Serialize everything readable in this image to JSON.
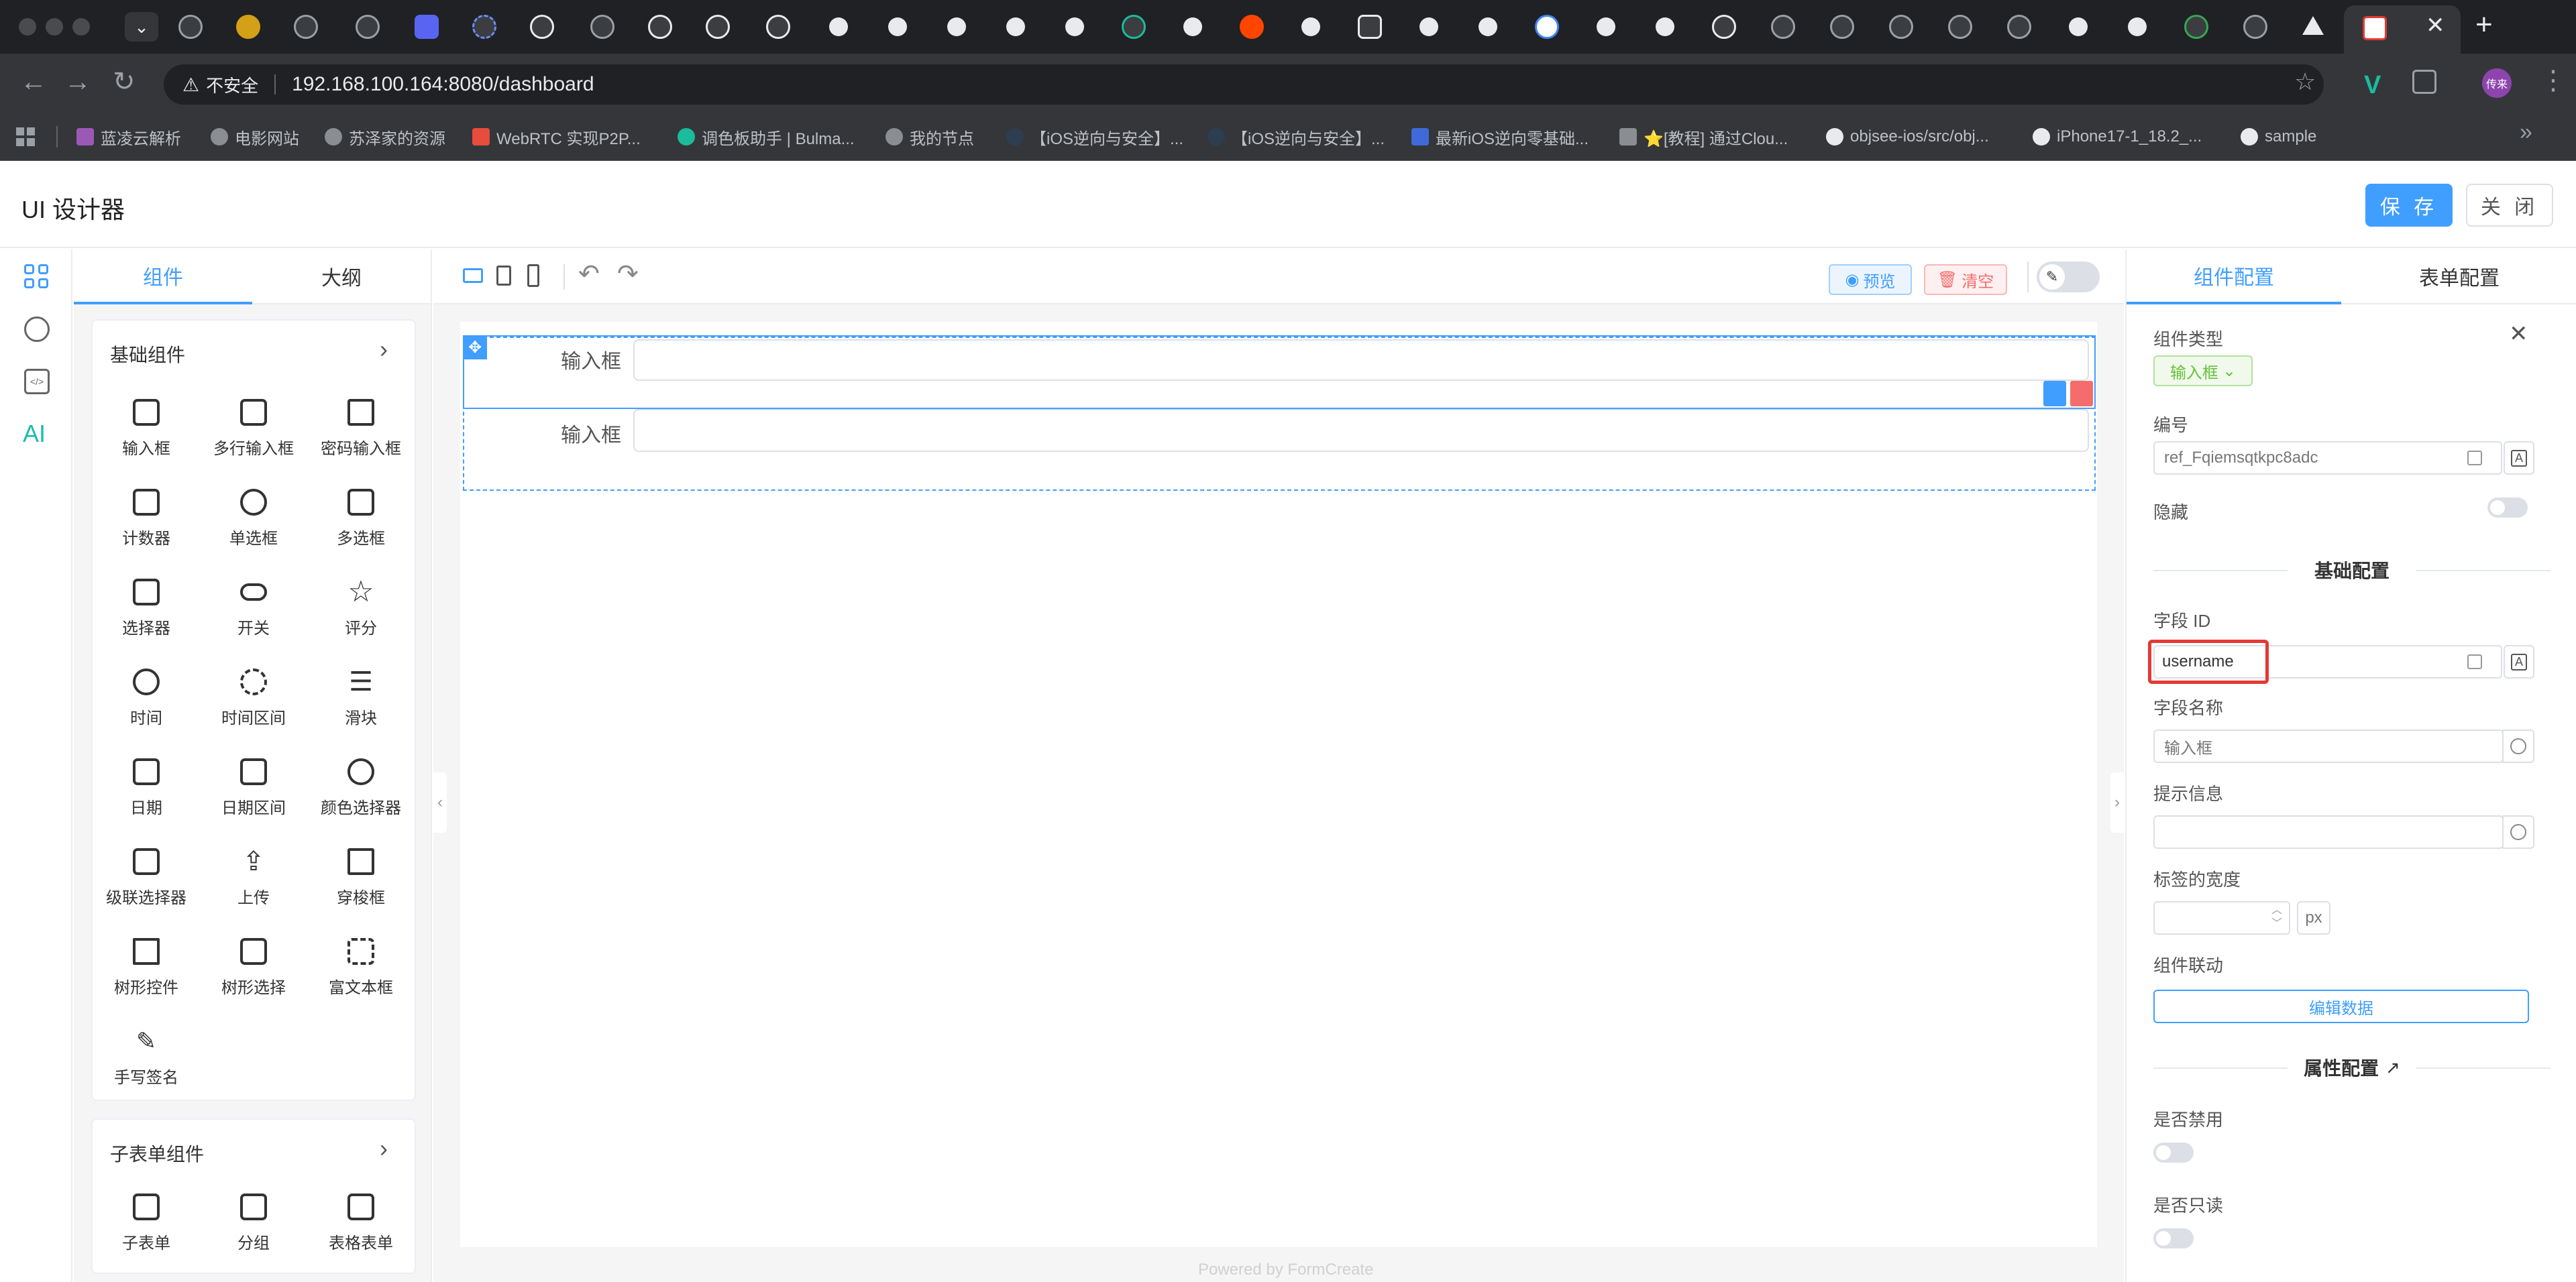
{
  "browser": {
    "url": "192.168.100.164:8080/dashboard",
    "not_secure_label": "不安全",
    "bookmarks": [
      "蓝凌云解析",
      "电影网站",
      "苏泽家的资源",
      "WebRTC 实现P2P...",
      "调色板助手 | Bulma...",
      "我的节点",
      "【iOS逆向与安全】...",
      "【iOS逆向与安全】...",
      "最新iOS逆向零基础...",
      "⭐[教程] 通过Clou...",
      "objsee-ios/src/obj...",
      "iPhone17-1_18.2_...",
      "sample"
    ],
    "profile_label": "传来"
  },
  "app": {
    "title": "UI 设计器",
    "save_label": "保 存",
    "close_label": "关 闭",
    "rail_ai_label": "AI",
    "left_tabs": [
      "组件",
      "大纲"
    ],
    "groups": [
      {
        "title": "基础组件",
        "items": [
          "输入框",
          "多行输入框",
          "密码输入框",
          "计数器",
          "单选框",
          "多选框",
          "选择器",
          "开关",
          "评分",
          "时间",
          "时间区间",
          "滑块",
          "日期",
          "日期区间",
          "颜色选择器",
          "级联选择器",
          "上传",
          "穿梭框",
          "树形控件",
          "树形选择",
          "富文本框",
          "手写签名"
        ]
      },
      {
        "title": "子表单组件",
        "items": [
          "子表单",
          "分组",
          "表格表单"
        ]
      }
    ],
    "canvas": {
      "preview_label": "预览",
      "clear_label": "清空",
      "fields": [
        {
          "label": "输入框",
          "value": ""
        },
        {
          "label": "输入框",
          "value": ""
        }
      ],
      "footer": "Powered by FormCreate"
    },
    "right": {
      "tabs": [
        "组件配置",
        "表单配置"
      ],
      "type_label": "组件类型",
      "type_value": "输入框",
      "id_label": "编号",
      "id_value": "ref_Fqiemsqtkpc8adc",
      "hidden_label": "隐藏",
      "hidden_on": false,
      "basic_section": "基础配置",
      "field_id_label": "字段 ID",
      "field_id_value": "username",
      "field_name_label": "字段名称",
      "field_name_value": "输入框",
      "hint_label": "提示信息",
      "hint_value": "",
      "label_width_label": "标签的宽度",
      "label_width_unit": "px",
      "linkage_label": "组件联动",
      "edit_data_label": "编辑数据",
      "attr_section": "属性配置",
      "disabled_label": "是否禁用",
      "readonly_label": "是否只读"
    }
  }
}
